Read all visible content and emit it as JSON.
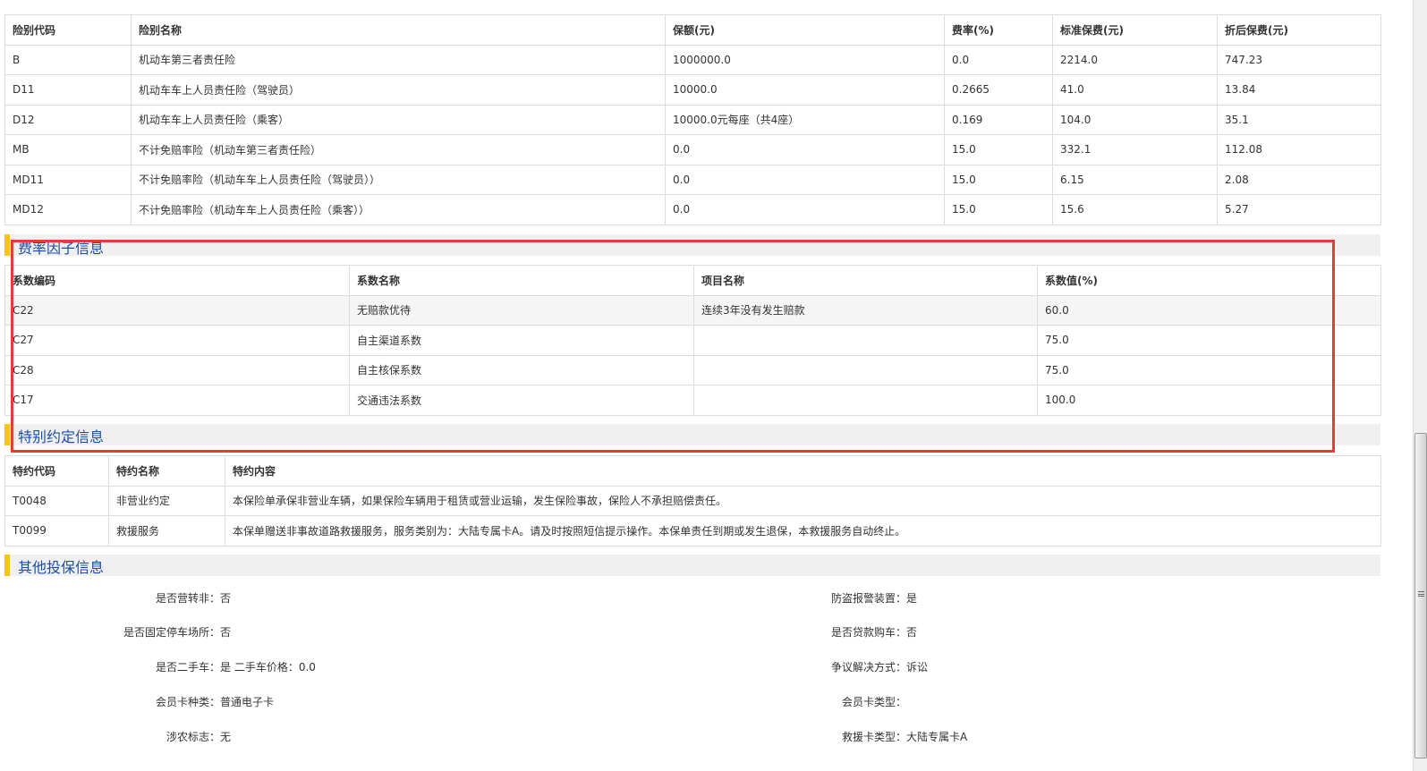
{
  "coverage_table": {
    "headers": [
      "险别代码",
      "险别名称",
      "保额(元)",
      "费率(%)",
      "标准保费(元)",
      "折后保费(元)"
    ],
    "rows": [
      [
        "B",
        "机动车第三者责任险",
        "1000000.0",
        "0.0",
        "2214.0",
        "747.23"
      ],
      [
        "D11",
        "机动车车上人员责任险（驾驶员）",
        "10000.0",
        "0.2665",
        "41.0",
        "13.84"
      ],
      [
        "D12",
        "机动车车上人员责任险（乘客）",
        "10000.0元每座（共4座）",
        "0.169",
        "104.0",
        "35.1"
      ],
      [
        "MB",
        "不计免赔率险（机动车第三者责任险）",
        "0.0",
        "15.0",
        "332.1",
        "112.08"
      ],
      [
        "MD11",
        "不计免赔率险（机动车车上人员责任险（驾驶员））",
        "0.0",
        "15.0",
        "6.15",
        "2.08"
      ],
      [
        "MD12",
        "不计免赔率险（机动车车上人员责任险（乘客））",
        "0.0",
        "15.0",
        "15.6",
        "5.27"
      ]
    ]
  },
  "rate_factor": {
    "title": "费率因子信息",
    "headers": [
      "系数编码",
      "系数名称",
      "项目名称",
      "系数值(%)"
    ],
    "rows": [
      [
        "C22",
        "无赔款优待",
        "连续3年没有发生赔款",
        "60.0"
      ],
      [
        "C27",
        "自主渠道系数",
        "",
        "75.0"
      ],
      [
        "C28",
        "自主核保系数",
        "",
        "75.0"
      ],
      [
        "C17",
        "交通违法系数",
        "",
        "100.0"
      ]
    ]
  },
  "special": {
    "title": "特别约定信息",
    "headers": [
      "特约代码",
      "特约名称",
      "特约内容"
    ],
    "rows": [
      [
        "T0048",
        "非营业约定",
        "本保险单承保非营业车辆，如果保险车辆用于租赁或营业运输，发生保险事故，保险人不承担赔偿责任。"
      ],
      [
        "T0099",
        "救援服务",
        "本保单赠送非事故道路救援服务，服务类别为：大陆专属卡A。请及时按照短信提示操作。本保单责任到期或发生退保，本救援服务自动终止。"
      ]
    ]
  },
  "other": {
    "title": "其他投保信息",
    "left": [
      {
        "label": "是否营转非：",
        "value": "否"
      },
      {
        "label": "是否固定停车场所：",
        "value": "否"
      },
      {
        "label": "是否二手车：",
        "value": "是  二手车价格：0.0"
      },
      {
        "label": "会员卡种类：",
        "value": "普通电子卡"
      },
      {
        "label": "涉农标志：",
        "value": "无"
      }
    ],
    "right": [
      {
        "label": "防盗报警装置：",
        "value": "是"
      },
      {
        "label": "是否贷款购车：",
        "value": "否"
      },
      {
        "label": "争议解决方式：",
        "value": "诉讼"
      },
      {
        "label": "会员卡类型：",
        "value": ""
      },
      {
        "label": "救援卡类型：",
        "value": "大陆专属卡A"
      }
    ]
  },
  "colors": {
    "accent": "#1b4ea8",
    "bar": "#f5c518",
    "highlight": "#e83a3a"
  }
}
